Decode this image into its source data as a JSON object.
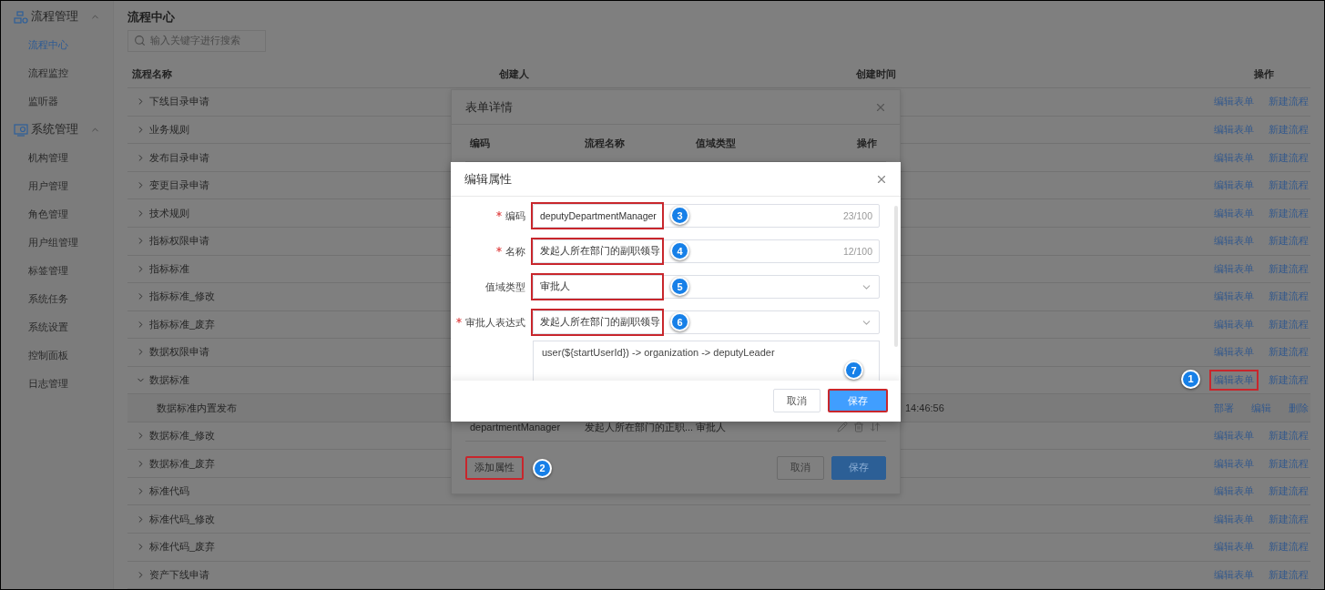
{
  "sidebar": {
    "groups": [
      {
        "label": "流程管理",
        "expanded": true,
        "items": [
          {
            "label": "流程中心",
            "selected": true
          },
          {
            "label": "流程监控",
            "selected": false
          },
          {
            "label": "监听器",
            "selected": false
          }
        ]
      },
      {
        "label": "系统管理",
        "expanded": true,
        "items": [
          {
            "label": "机构管理",
            "selected": false
          },
          {
            "label": "用户管理",
            "selected": false
          },
          {
            "label": "角色管理",
            "selected": false
          },
          {
            "label": "用户组管理",
            "selected": false
          },
          {
            "label": "标签管理",
            "selected": false
          },
          {
            "label": "系统任务",
            "selected": false
          },
          {
            "label": "系统设置",
            "selected": false
          },
          {
            "label": "控制面板",
            "selected": false
          },
          {
            "label": "日志管理",
            "selected": false
          }
        ]
      }
    ]
  },
  "page": {
    "title": "流程中心",
    "search": {
      "placeholder": "输入关键字进行搜索"
    },
    "table": {
      "columns": [
        "流程名称",
        "创建人",
        "创建时间",
        "操作"
      ],
      "rows": [
        {
          "name": "下线目录申请",
          "expanded": false,
          "actions": [
            {
              "label": "编辑表单"
            },
            {
              "label": "新建流程"
            }
          ]
        },
        {
          "name": "业务规则",
          "expanded": false,
          "actions": [
            {
              "label": "编辑表单"
            },
            {
              "label": "新建流程"
            }
          ]
        },
        {
          "name": "发布目录申请",
          "expanded": false,
          "actions": [
            {
              "label": "编辑表单"
            },
            {
              "label": "新建流程"
            }
          ]
        },
        {
          "name": "变更目录申请",
          "expanded": false,
          "actions": [
            {
              "label": "编辑表单"
            },
            {
              "label": "新建流程"
            }
          ]
        },
        {
          "name": "技术规则",
          "expanded": false,
          "actions": [
            {
              "label": "编辑表单"
            },
            {
              "label": "新建流程"
            }
          ]
        },
        {
          "name": "指标权限申请",
          "expanded": false,
          "actions": [
            {
              "label": "编辑表单"
            },
            {
              "label": "新建流程"
            }
          ]
        },
        {
          "name": "指标标准",
          "expanded": false,
          "actions": [
            {
              "label": "编辑表单"
            },
            {
              "label": "新建流程"
            }
          ]
        },
        {
          "name": "指标标准_修改",
          "expanded": false,
          "actions": [
            {
              "label": "编辑表单"
            },
            {
              "label": "新建流程"
            }
          ]
        },
        {
          "name": "指标标准_废弃",
          "expanded": false,
          "actions": [
            {
              "label": "编辑表单"
            },
            {
              "label": "新建流程"
            }
          ]
        },
        {
          "name": "数据权限申请",
          "expanded": false,
          "actions": [
            {
              "label": "编辑表单"
            },
            {
              "label": "新建流程"
            }
          ]
        },
        {
          "name": "数据标准",
          "expanded": true,
          "actions": [
            {
              "label": "编辑表单",
              "callout": "1"
            },
            {
              "label": "新建流程"
            }
          ],
          "children": [
            {
              "name": "数据标准内置发布",
              "time": "14:46:56",
              "actions": [
                {
                  "label": "部署"
                },
                {
                  "label": "编辑"
                },
                {
                  "label": "删除"
                }
              ]
            }
          ]
        },
        {
          "name": "数据标准_修改",
          "expanded": false,
          "actions": [
            {
              "label": "编辑表单"
            },
            {
              "label": "新建流程"
            }
          ]
        },
        {
          "name": "数据标准_废弃",
          "expanded": false,
          "actions": [
            {
              "label": "编辑表单"
            },
            {
              "label": "新建流程"
            }
          ]
        },
        {
          "name": "标准代码",
          "expanded": false,
          "actions": [
            {
              "label": "编辑表单"
            },
            {
              "label": "新建流程"
            }
          ]
        },
        {
          "name": "标准代码_修改",
          "expanded": false,
          "actions": [
            {
              "label": "编辑表单"
            },
            {
              "label": "新建流程"
            }
          ]
        },
        {
          "name": "标准代码_废弃",
          "expanded": false,
          "actions": [
            {
              "label": "编辑表单"
            },
            {
              "label": "新建流程"
            }
          ]
        },
        {
          "name": "资产下线申请",
          "expanded": false,
          "actions": [
            {
              "label": "编辑表单"
            },
            {
              "label": "新建流程"
            }
          ]
        }
      ]
    }
  },
  "form_detail_dialog": {
    "title": "表单详情",
    "columns": [
      "编码",
      "流程名称",
      "值域类型",
      "操作"
    ],
    "rows": [
      {
        "code": "departmentManager",
        "name": "发起人所在部门的正职...",
        "type": "审批人"
      }
    ],
    "add_button": {
      "label": "添加属性",
      "callout": "2"
    },
    "buttons": [
      {
        "label": "取消",
        "kind": "default"
      },
      {
        "label": "保存",
        "kind": "primary"
      }
    ]
  },
  "edit_dialog": {
    "title": "编辑属性",
    "fields": [
      {
        "kind": "text",
        "label": "编码",
        "required": true,
        "value": "deputyDepartmentManager",
        "counter": "23/100",
        "callout": "3"
      },
      {
        "kind": "text",
        "label": "名称",
        "required": true,
        "value": "发起人所在部门的副职领导",
        "counter": "12/100",
        "callout": "4"
      },
      {
        "kind": "select",
        "label": "值域类型",
        "required": false,
        "value": "审批人",
        "callout": "5"
      },
      {
        "kind": "select",
        "label": "审批人表达式",
        "required": true,
        "value": "发起人所在部门的副职领导",
        "callout": "6"
      }
    ],
    "expression": "user(${startUserId}) -> organization -> deputyLeader",
    "buttons": [
      {
        "label": "取消",
        "kind": "default"
      },
      {
        "label": "保存",
        "kind": "primary",
        "callout": "7"
      }
    ]
  }
}
